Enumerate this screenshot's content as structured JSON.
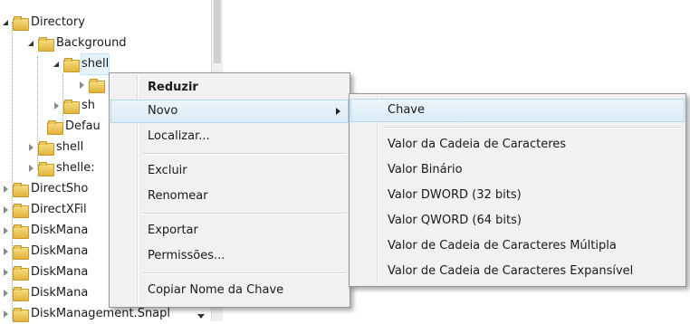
{
  "tree": {
    "items": [
      {
        "label": "Directory"
      },
      {
        "label": "Background"
      },
      {
        "label": "shell"
      },
      {
        "label": ""
      },
      {
        "label": "sh"
      },
      {
        "label": "Defau"
      },
      {
        "label": "shell"
      },
      {
        "label": "shelle:"
      },
      {
        "label": "DirectSho"
      },
      {
        "label": "DirectXFil"
      },
      {
        "label": "DiskMana"
      },
      {
        "label": "DiskMana"
      },
      {
        "label": "DiskMana"
      },
      {
        "label": "DiskMana"
      },
      {
        "label": "DiskManagement.Snapl"
      }
    ]
  },
  "context_menu": {
    "collapse": "Reduzir",
    "new": "Novo",
    "find": "Localizar...",
    "delete": "Excluir",
    "rename": "Renomear",
    "export": "Exportar",
    "permissions": "Permissões...",
    "copy_key_name": "Copiar Nome da Chave"
  },
  "new_submenu": {
    "key": "Chave",
    "string_value": "Valor da Cadeia de Caracteres",
    "binary_value": "Valor Binário",
    "dword_value": "Valor DWORD (32 bits)",
    "qword_value": "Valor QWORD (64 bits)",
    "multi_string_value": "Valor de Cadeia de Caracteres Múltipla",
    "expandable_string_value": "Valor de Cadeia de Caracteres Expansível"
  },
  "colors": {
    "menu_bg": "#f1f1f1",
    "highlight": "#dcecf8",
    "folder": "#e1b33c"
  }
}
